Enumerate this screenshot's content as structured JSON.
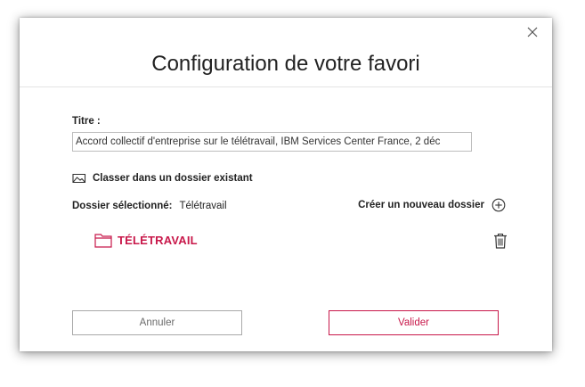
{
  "dialog": {
    "title": "Configuration de votre favori",
    "close_icon": "close-icon"
  },
  "form": {
    "title_label": "Titre :",
    "title_value": "Accord collectif d'entreprise sur le télétravail, IBM Services Center France, 2 déc"
  },
  "folders": {
    "classify_label": "Classer dans un dossier existant",
    "classify_icon": "folder-open-icon",
    "selected_label": "Dossier sélectionné:",
    "selected_value": "Télétravail",
    "create_label": "Créer un nouveau dossier",
    "create_icon": "plus-circle-icon",
    "items": [
      {
        "name": "TÉLÉTRAVAIL",
        "icon": "folder-icon",
        "delete_icon": "trash-icon"
      }
    ]
  },
  "actions": {
    "cancel_label": "Annuler",
    "validate_label": "Valider"
  },
  "colors": {
    "accent": "#c8184a",
    "text": "#222222",
    "border": "#bdbdbd"
  }
}
